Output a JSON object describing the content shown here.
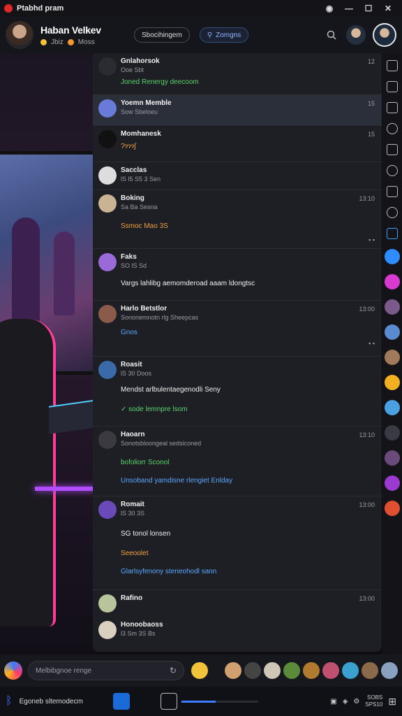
{
  "window": {
    "title": "Ptabhd pram",
    "controls": [
      "◉",
      "—",
      "☐",
      "✕"
    ]
  },
  "header": {
    "user_name": "Haban Velkev",
    "status_a": "Jbiz",
    "status_b": "Moss",
    "pill_primary": "Sbocihingem",
    "pill_secondary": "Zomgns",
    "search_icon": "search-icon"
  },
  "messages": [
    {
      "name": "Gnlahorsok",
      "meta": "Ooe  Sbt",
      "time": "12",
      "lines": [
        {
          "text": "Joned  Renergy deecoom",
          "color": "green"
        }
      ]
    },
    {
      "name": "Yoemn Memble",
      "meta": "Sow  Sbeloeu",
      "time": "15",
      "lines": []
    },
    {
      "name": "Momhanesk",
      "meta": "",
      "time": "15",
      "lines": [
        {
          "text": "Ɂɂɂɂʃ",
          "color": "orange"
        }
      ]
    },
    {
      "name": "Sacclas",
      "meta": "lS  l5  S5  3  Sen",
      "time": "",
      "lines": []
    },
    {
      "name": "Boking",
      "meta": "Sa  Ba  Sesna",
      "time": "13:10",
      "lines": [
        {
          "text": "Ssmoc Mao  3S",
          "color": "orange"
        }
      ]
    },
    {
      "name": "Faks",
      "meta": "SO  lS  Sd",
      "time": "",
      "lines": [
        {
          "text": "Vargs lahlibg aemomderoad aaam  ldongtsc",
          "color": "white"
        }
      ]
    },
    {
      "name": "Harlo Betstlor",
      "meta": "Sononemnotn rlg  Sheepcas",
      "time": "13:00",
      "lines": [
        {
          "text": "Gnos",
          "color": "blue"
        }
      ]
    },
    {
      "name": "Roasit",
      "meta": "lS  30  Doos",
      "time": "",
      "lines": [
        {
          "text": "Mendst arlbulentaegenodli Seny",
          "color": "white"
        },
        {
          "text": "✓ sode lemnpre lsom",
          "color": "green"
        }
      ]
    },
    {
      "name": "Haoarn",
      "meta": "Sonotsbloongeal  sedsiconed",
      "time": "13:10",
      "lines": [
        {
          "text": "bofoliorr  Sconol",
          "color": "green"
        },
        {
          "text": "Unsoband yamdisne rlengiet Enlday",
          "color": "blue"
        }
      ]
    },
    {
      "name": "Romait",
      "meta": "lS  30  3S",
      "time": "13:00",
      "lines": [
        {
          "text": "SG  tonol lonsen",
          "color": "white"
        },
        {
          "text": "Seeoolet",
          "color": "orange"
        },
        {
          "text": "Glarlsyfenony  steneohodl sann",
          "color": "blue"
        }
      ]
    },
    {
      "name": "Rafino",
      "meta": "",
      "time": "13:00",
      "lines": []
    },
    {
      "name": "Honoobaoss",
      "meta": "l3  Sm  3S  Bs",
      "time": "",
      "lines": []
    }
  ],
  "composer": {
    "placeholder": "Melbibgnoe renge"
  },
  "bottombar": {
    "label": "Egoneb sltemodecm",
    "progress": 0.45,
    "stat_line1": "SOBS",
    "stat_line2": "SPS10"
  }
}
